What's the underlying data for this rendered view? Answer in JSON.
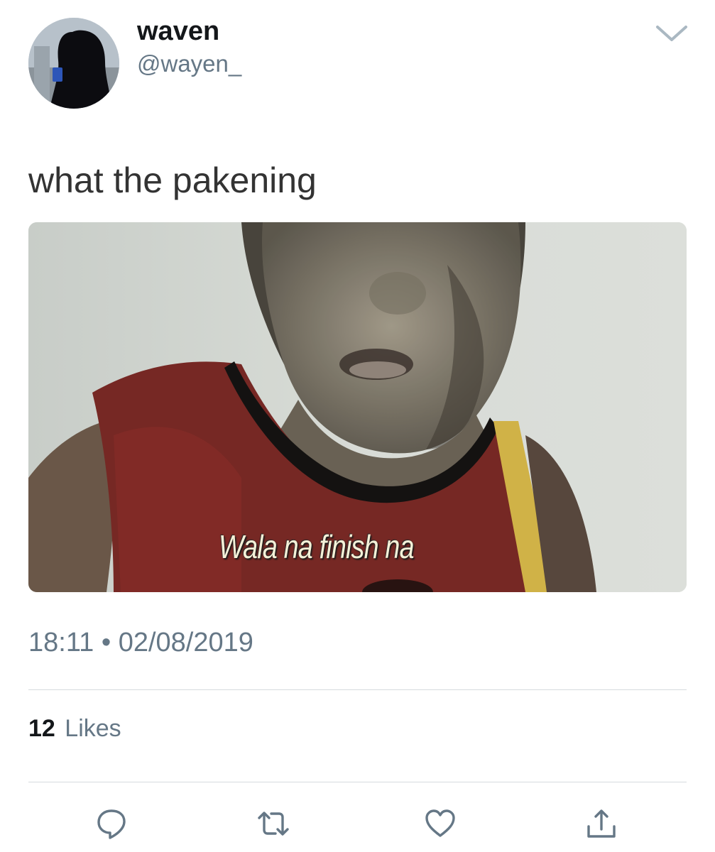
{
  "tweet": {
    "author": {
      "display_name": "waven",
      "handle": "@wayen_"
    },
    "text": "what the pakening",
    "media": {
      "caption_overlay": "Wala na finish na"
    },
    "time": "18:11",
    "separator": "•",
    "date": "02/08/2019",
    "likes": {
      "count": "12",
      "label": "Likes"
    }
  },
  "icons": {
    "menu": "chevron-down-icon",
    "reply": "reply-icon",
    "retweet": "retweet-icon",
    "like": "heart-icon",
    "share": "share-icon"
  },
  "colors": {
    "text_primary": "#14171a",
    "text_secondary": "#657786",
    "icon_gray": "#657786",
    "divider": "#d5dade"
  }
}
